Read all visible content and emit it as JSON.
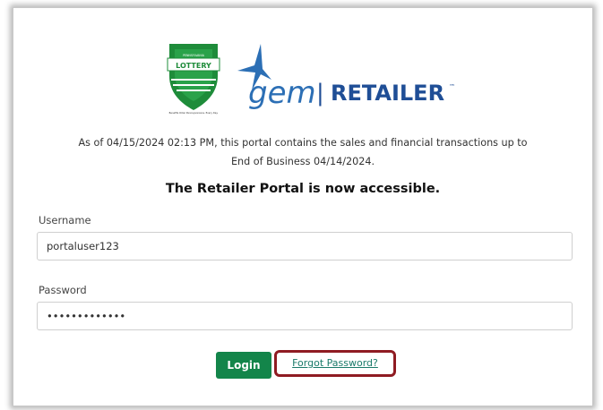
{
  "logo": {
    "lottery_text": "LOTTERY",
    "lottery_small_top": "PENNSYLVANIA",
    "lottery_small_bottom": "Benefits Older Pennsylvanians. Every Day.",
    "gem_text": "gem",
    "separator": "|",
    "retailer_text": "RETAILER",
    "trademark": "™"
  },
  "notice": {
    "line1": "As of 04/15/2024 02:13 PM, this portal contains the sales and financial transactions up to",
    "line2": "End of Business 04/14/2024."
  },
  "headline": "The Retailer Portal is now accessible.",
  "form": {
    "username_label": "Username",
    "username_value": "portaluser123",
    "password_label": "Password",
    "password_value": "•••••••••••••"
  },
  "buttons": {
    "login_label": "Login",
    "forgot_label": "Forgot Password?"
  },
  "colors": {
    "brand_green": "#13854a",
    "lottery_green": "#1e8c3a",
    "gem_blue": "#2c6fb5",
    "retailer_blue": "#1f4e96",
    "highlight_red": "#8f1b22"
  }
}
